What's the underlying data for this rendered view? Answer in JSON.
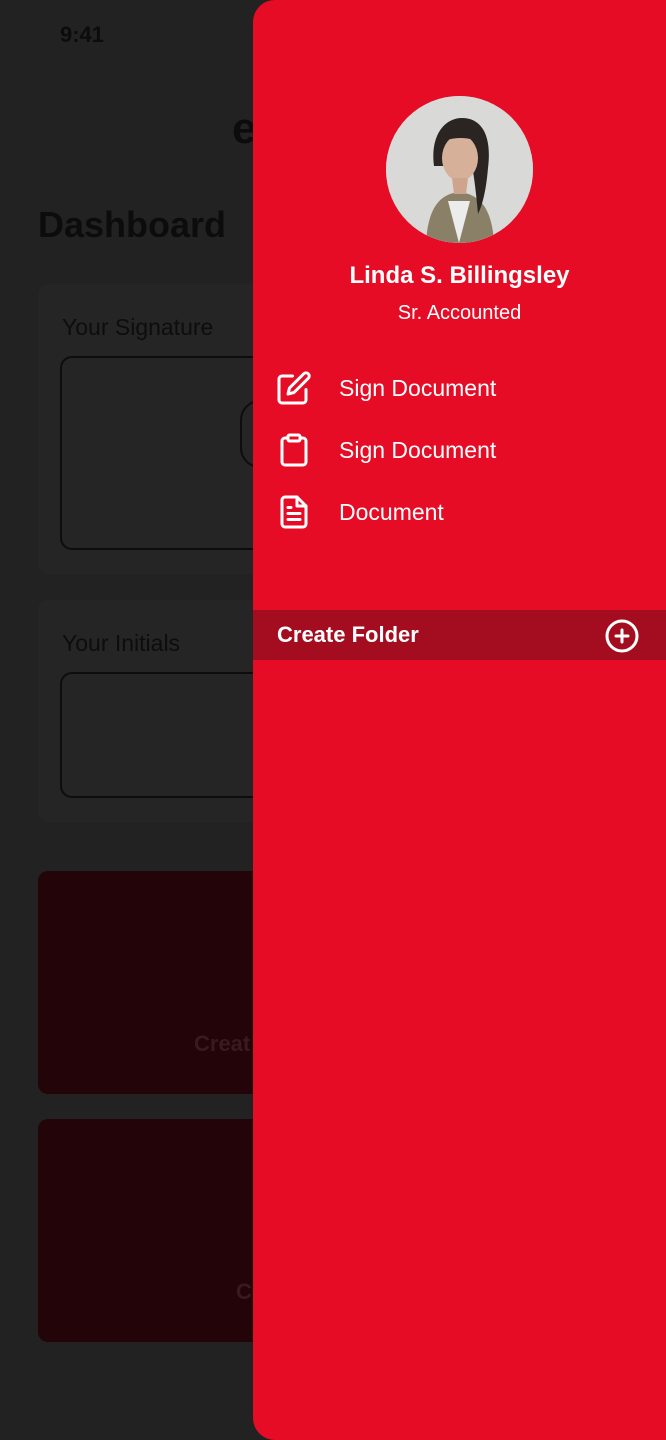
{
  "status_bar": {
    "time": "9:41"
  },
  "background": {
    "logo_fragment": "e",
    "page_title": "Dashboard",
    "signature_card": {
      "label": "Your Signature"
    },
    "initials_card": {
      "label": "Your Initials"
    },
    "action_cards": [
      {
        "label_fragment": "Creat"
      },
      {
        "label_fragment": "C"
      }
    ]
  },
  "drawer": {
    "user": {
      "name": "Linda S. Billingsley",
      "role": "Sr. Accounted"
    },
    "menu": [
      {
        "label": "Sign Document",
        "icon": "edit-icon"
      },
      {
        "label": "Sign Document",
        "icon": "clipboard-icon"
      },
      {
        "label": "Document",
        "icon": "file-text-icon"
      }
    ],
    "folder": {
      "label": "Create Folder",
      "icon": "plus-circle-icon"
    }
  },
  "colors": {
    "drawer_bg": "#e60c25",
    "folder_bar_bg": "#a30d1f",
    "overlay_bg": "#222222",
    "text_on_drawer": "#ffffff"
  }
}
